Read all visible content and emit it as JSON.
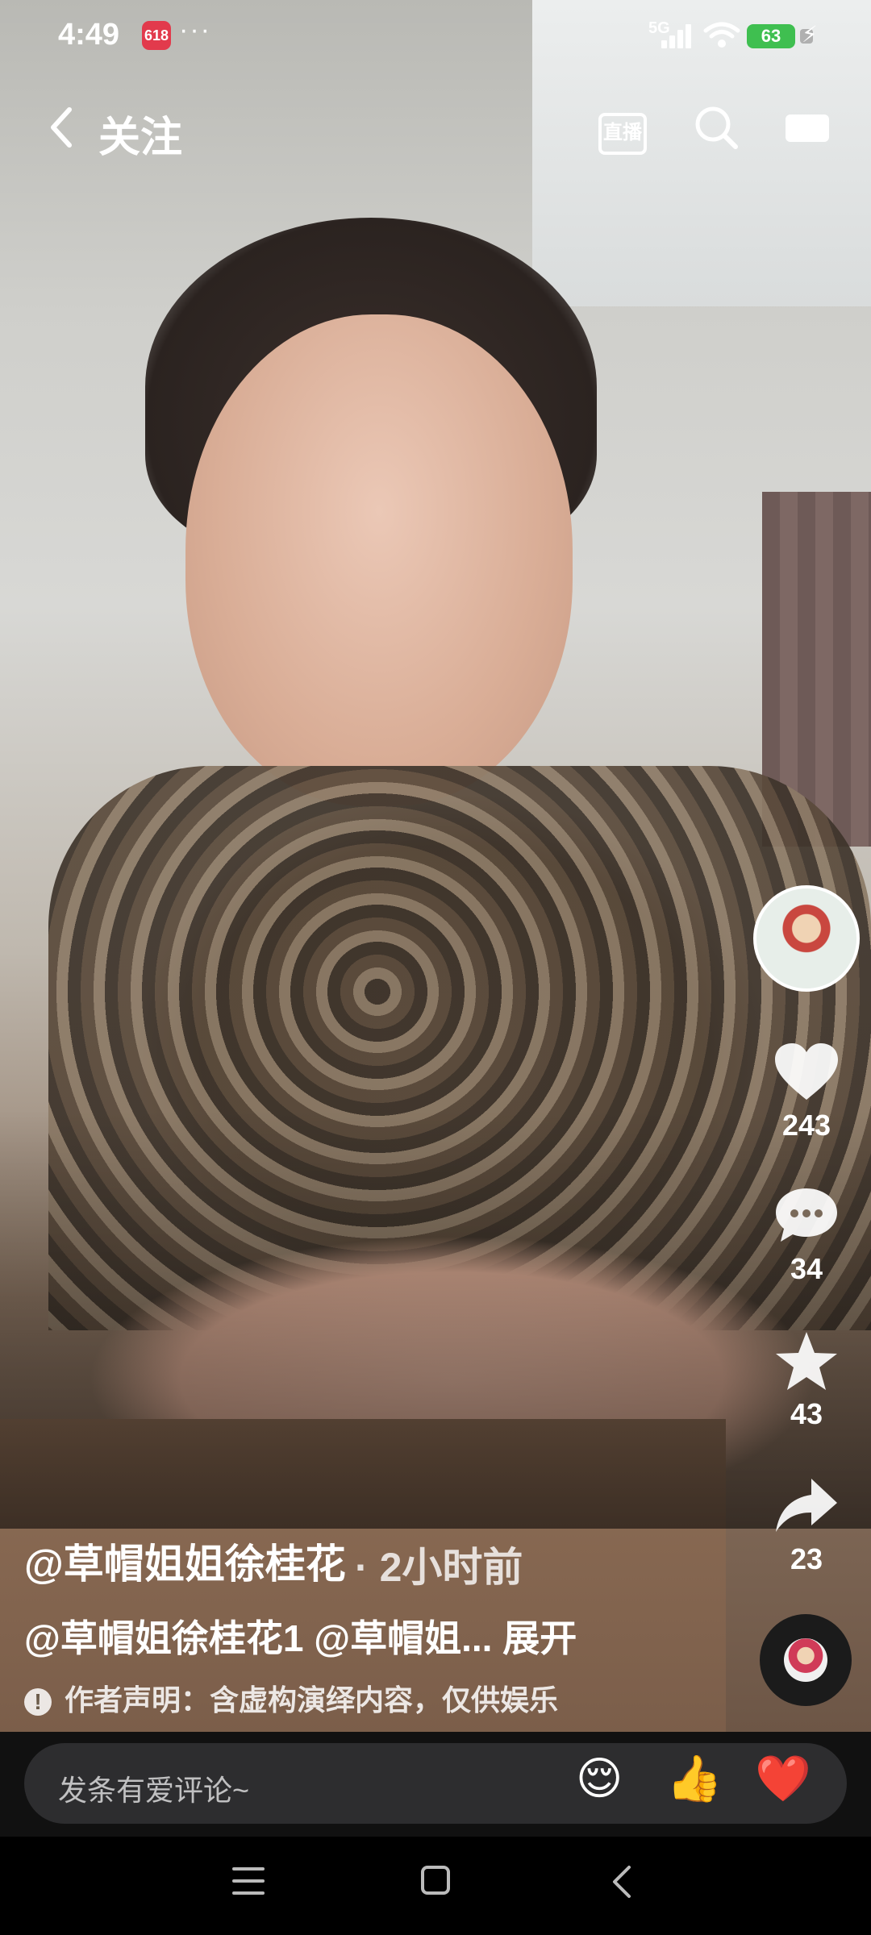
{
  "status_bar": {
    "time": "4:49",
    "app_badge": "618",
    "network": "5G",
    "battery": "63"
  },
  "top_nav": {
    "title": "关注",
    "live_label": "直播"
  },
  "right_rail": {
    "likes": "243",
    "comments": "34",
    "favorites": "43",
    "shares": "23"
  },
  "caption": {
    "author": "@草帽姐姐徐桂花",
    "separator": "·",
    "time_ago": "2小时前",
    "description": "@草帽姐徐桂花1 @草帽姐...",
    "expand_label": "展开",
    "notice": "作者声明：含虚构演绎内容，仅供娱乐"
  },
  "comment_bar": {
    "placeholder": "发条有爱评论~",
    "emojis": [
      "😌",
      "👍",
      "❤️"
    ]
  },
  "icons": {
    "back": "chevron-left-icon",
    "live": "live-tv-icon",
    "search": "search-icon",
    "more": "more-icon",
    "like": "heart-icon",
    "comment": "chat-bubble-icon",
    "favorite": "star-icon",
    "share": "share-arrow-icon"
  },
  "colors": {
    "battery": "#3fbf50",
    "comment_bar_bg": "#2d2d2f"
  }
}
